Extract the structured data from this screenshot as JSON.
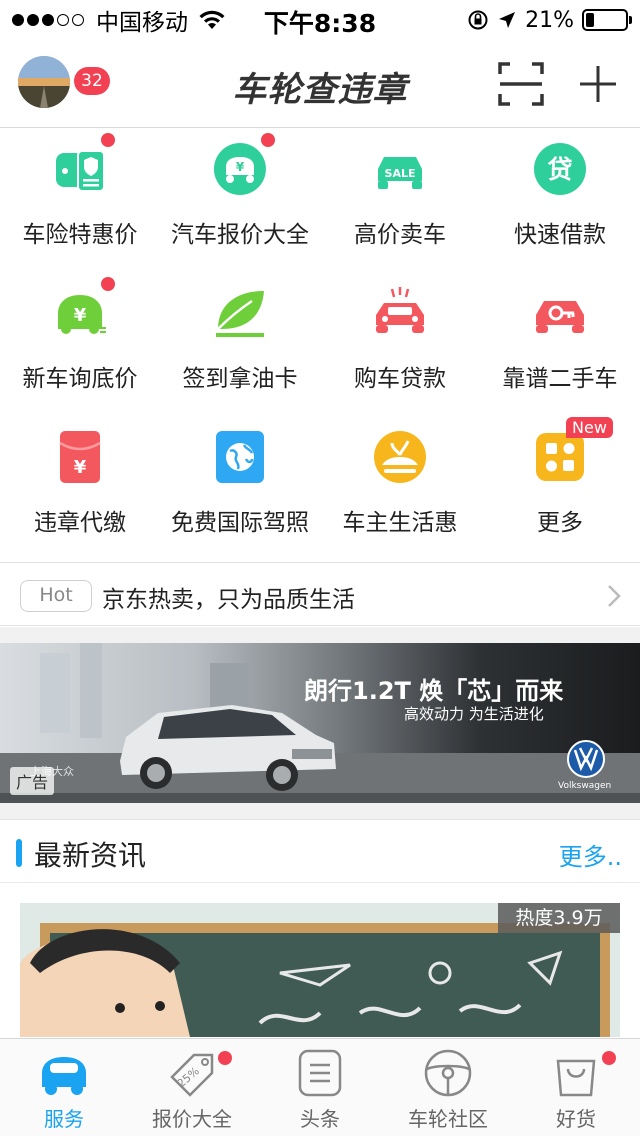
{
  "status_bar": {
    "carrier": "中国移动",
    "time": "下午8:38",
    "battery_percent": "21%",
    "battery_level": 0.21
  },
  "header": {
    "avatar_badge": "32",
    "logo": "车轮查违章",
    "scan_icon": "scan-icon",
    "add_icon": "plus-icon"
  },
  "services": [
    {
      "label": "车险特惠价",
      "icon": "car-insurance-icon",
      "color": "#2fcf9b",
      "dot": true
    },
    {
      "label": "汽车报价大全",
      "icon": "car-price-icon",
      "color": "#2fcf9b",
      "dot": true
    },
    {
      "label": "高价卖车",
      "icon": "car-sale-icon",
      "color": "#2fcf9b",
      "dot": false
    },
    {
      "label": "快速借款",
      "icon": "loan-icon",
      "color": "#2fcf9b",
      "dot": false
    },
    {
      "label": "新车询底价",
      "icon": "new-car-price-icon",
      "color": "#6fcf3a",
      "dot": true
    },
    {
      "label": "签到拿油卡",
      "icon": "leaf-checkin-icon",
      "color": "#6fcf3a",
      "dot": false
    },
    {
      "label": "购车贷款",
      "icon": "car-loan-icon",
      "color": "#f4585f",
      "dot": false
    },
    {
      "label": "靠谱二手车",
      "icon": "used-car-key-icon",
      "color": "#f4585f",
      "dot": false
    },
    {
      "label": "违章代缴",
      "icon": "red-envelope-icon",
      "color": "#f4585f",
      "dot": false
    },
    {
      "label": "免费国际驾照",
      "icon": "globe-icon",
      "color": "#2ea8f3",
      "dot": false
    },
    {
      "label": "车主生活惠",
      "icon": "lifestyle-icon",
      "color": "#f8b61d",
      "dot": false
    },
    {
      "label": "更多",
      "icon": "more-apps-icon",
      "color": "#f8b61d",
      "dot": false
    }
  ],
  "new_badge": "New",
  "hot": {
    "tag": "Hot",
    "text": "京东热卖，只为品质生活"
  },
  "banner": {
    "headline": "朗行1.2T 焕「芯」而来",
    "subline": "高效动力 为生活进化",
    "brand_small": "上海大众",
    "brand": "Volkswagen",
    "ad_tag": "广告"
  },
  "news": {
    "title": "最新资讯",
    "more": "更多..",
    "heat": "热度3.9万"
  },
  "tabs": [
    {
      "label": "服务",
      "icon": "car-service-icon",
      "active": true,
      "dot": false
    },
    {
      "label": "报价大全",
      "icon": "price-tag-icon",
      "active": false,
      "dot": true
    },
    {
      "label": "头条",
      "icon": "news-list-icon",
      "active": false,
      "dot": false
    },
    {
      "label": "车轮社区",
      "icon": "steering-wheel-icon",
      "active": false,
      "dot": false
    },
    {
      "label": "好货",
      "icon": "shopping-bag-icon",
      "active": false,
      "dot": true
    }
  ]
}
